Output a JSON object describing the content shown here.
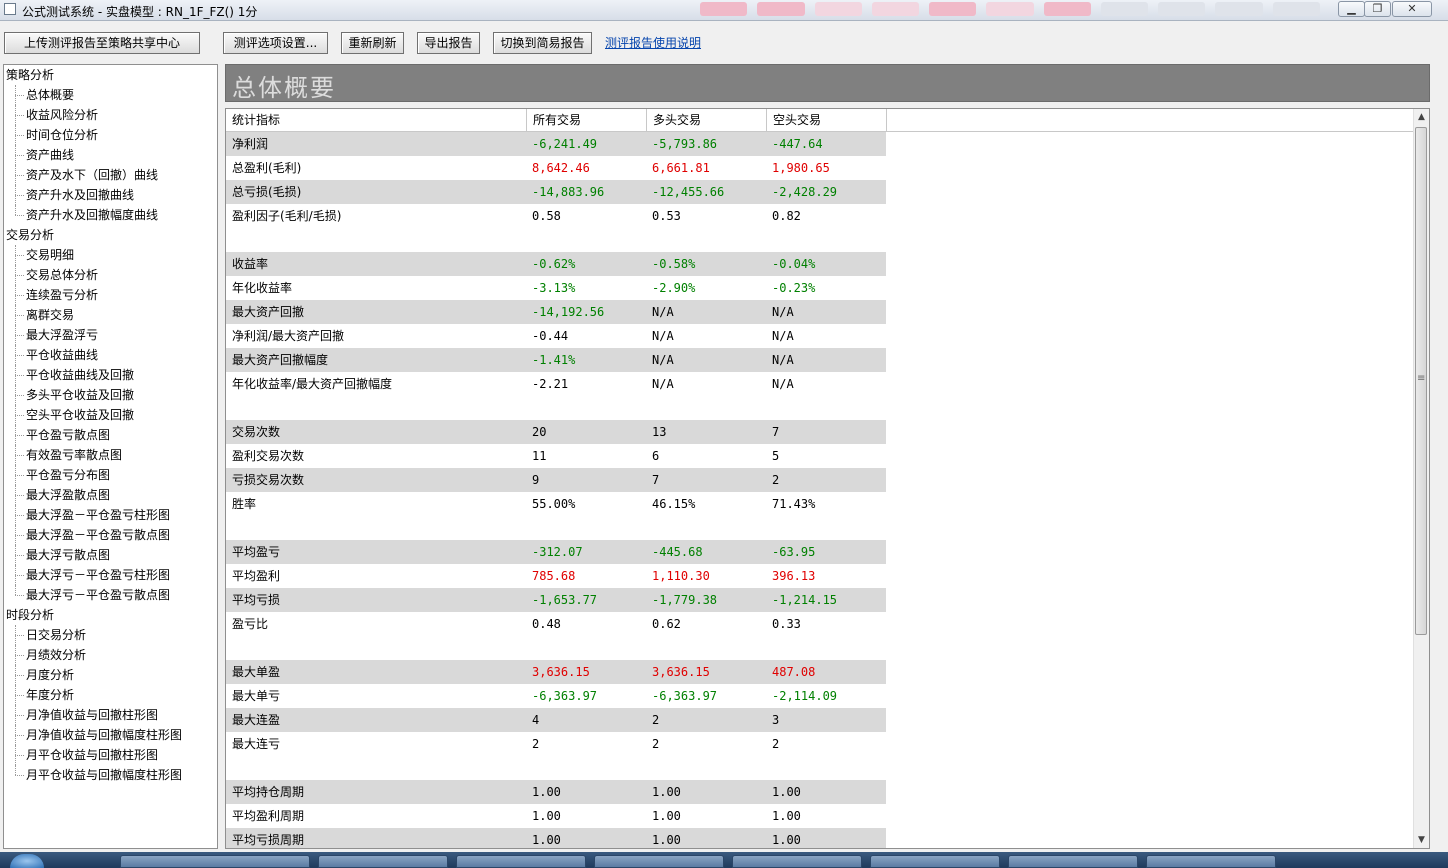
{
  "window": {
    "title": "公式测试系统 - 实盘模型 : RN_1F_FZ() 1分",
    "min_glyph": "▁",
    "max_glyph": "❐",
    "close_glyph": "✕"
  },
  "toolbar": {
    "upload_label": "上传测评报告至策略共享中心",
    "options_label": "测评选项设置...",
    "refresh_label": "重新刷新",
    "export_label": "导出报告",
    "switch_label": "切换到简易报告",
    "help_link": "测评报告使用说明"
  },
  "sidebar": {
    "groups": [
      {
        "label": "策略分析",
        "items": [
          "总体概要",
          "收益风险分析",
          "时间仓位分析",
          "资产曲线",
          "资产及水下（回撤）曲线",
          "资产升水及回撤曲线",
          "资产升水及回撤幅度曲线"
        ]
      },
      {
        "label": "交易分析",
        "items": [
          "交易明细",
          "交易总体分析",
          "连续盈亏分析",
          "离群交易",
          "最大浮盈浮亏",
          "平仓收益曲线",
          "平仓收益曲线及回撤",
          "多头平仓收益及回撤",
          "空头平仓收益及回撤",
          "平仓盈亏散点图",
          "有效盈亏率散点图",
          "平仓盈亏分布图",
          "最大浮盈散点图",
          "最大浮盈－平仓盈亏柱形图",
          "最大浮盈－平仓盈亏散点图",
          "最大浮亏散点图",
          "最大浮亏－平仓盈亏柱形图",
          "最大浮亏－平仓盈亏散点图"
        ]
      },
      {
        "label": "时段分析",
        "items": [
          "日交易分析",
          "月绩效分析",
          "月度分析",
          "年度分析",
          "月净值收益与回撤柱形图",
          "月净值收益与回撤幅度柱形图",
          "月平仓收益与回撤柱形图",
          "月平仓收益与回撤幅度柱形图"
        ]
      }
    ]
  },
  "main": {
    "title": "总体概要",
    "columns": [
      "统计指标",
      "所有交易",
      "多头交易",
      "空头交易"
    ],
    "rows": [
      {
        "label": "净利润",
        "values": [
          "-6,241.49",
          "-5,793.86",
          "-447.64"
        ]
      },
      {
        "label": "总盈利(毛利)",
        "values": [
          "8,642.46",
          "6,661.81",
          "1,980.65"
        ]
      },
      {
        "label": "总亏损(毛损)",
        "values": [
          "-14,883.96",
          "-12,455.66",
          "-2,428.29"
        ]
      },
      {
        "label": "盈利因子(毛利/毛损)",
        "values": [
          "0.58",
          "0.53",
          "0.82"
        ]
      },
      {
        "label": "",
        "values": [
          "",
          "",
          ""
        ]
      },
      {
        "label": "收益率",
        "values": [
          "-0.62%",
          "-0.58%",
          "-0.04%"
        ]
      },
      {
        "label": "年化收益率",
        "values": [
          "-3.13%",
          "-2.90%",
          "-0.23%"
        ]
      },
      {
        "label": "最大资产回撤",
        "values": [
          "-14,192.56",
          "N/A",
          "N/A"
        ]
      },
      {
        "label": "净利润/最大资产回撤",
        "values": [
          "-0.44",
          "N/A",
          "N/A"
        ]
      },
      {
        "label": "最大资产回撤幅度",
        "values": [
          "-1.41%",
          "N/A",
          "N/A"
        ]
      },
      {
        "label": "年化收益率/最大资产回撤幅度",
        "values": [
          "-2.21",
          "N/A",
          "N/A"
        ]
      },
      {
        "label": "",
        "values": [
          "",
          "",
          ""
        ]
      },
      {
        "label": "交易次数",
        "values": [
          "20",
          "13",
          "7"
        ]
      },
      {
        "label": "盈利交易次数",
        "values": [
          "11",
          "6",
          "5"
        ]
      },
      {
        "label": "亏损交易次数",
        "values": [
          "9",
          "7",
          "2"
        ]
      },
      {
        "label": "胜率",
        "values": [
          "55.00%",
          "46.15%",
          "71.43%"
        ]
      },
      {
        "label": "",
        "values": [
          "",
          "",
          ""
        ]
      },
      {
        "label": "平均盈亏",
        "values": [
          "-312.07",
          "-445.68",
          "-63.95"
        ]
      },
      {
        "label": "平均盈利",
        "values": [
          "785.68",
          "1,110.30",
          "396.13"
        ]
      },
      {
        "label": "平均亏损",
        "values": [
          "-1,653.77",
          "-1,779.38",
          "-1,214.15"
        ]
      },
      {
        "label": "盈亏比",
        "values": [
          "0.48",
          "0.62",
          "0.33"
        ]
      },
      {
        "label": "",
        "values": [
          "",
          "",
          ""
        ]
      },
      {
        "label": "最大单盈",
        "values": [
          "3,636.15",
          "3,636.15",
          "487.08"
        ]
      },
      {
        "label": "最大单亏",
        "values": [
          "-6,363.97",
          "-6,363.97",
          "-2,114.09"
        ]
      },
      {
        "label": "最大连盈",
        "values": [
          "4",
          "2",
          "3"
        ]
      },
      {
        "label": "最大连亏",
        "values": [
          "2",
          "2",
          "2"
        ]
      },
      {
        "label": "",
        "values": [
          "",
          "",
          ""
        ]
      },
      {
        "label": "平均持仓周期",
        "values": [
          "1.00",
          "1.00",
          "1.00"
        ]
      },
      {
        "label": "平均盈利周期",
        "values": [
          "1.00",
          "1.00",
          "1.00"
        ]
      },
      {
        "label": "平均亏损周期",
        "values": [
          "1.00",
          "1.00",
          "1.00"
        ]
      }
    ],
    "value_colors": {
      "negative": "#008000",
      "positive": "#e00000"
    }
  },
  "scrollbar": {
    "up_glyph": "▲",
    "down_glyph": "▼",
    "grip_glyph": "≡"
  }
}
